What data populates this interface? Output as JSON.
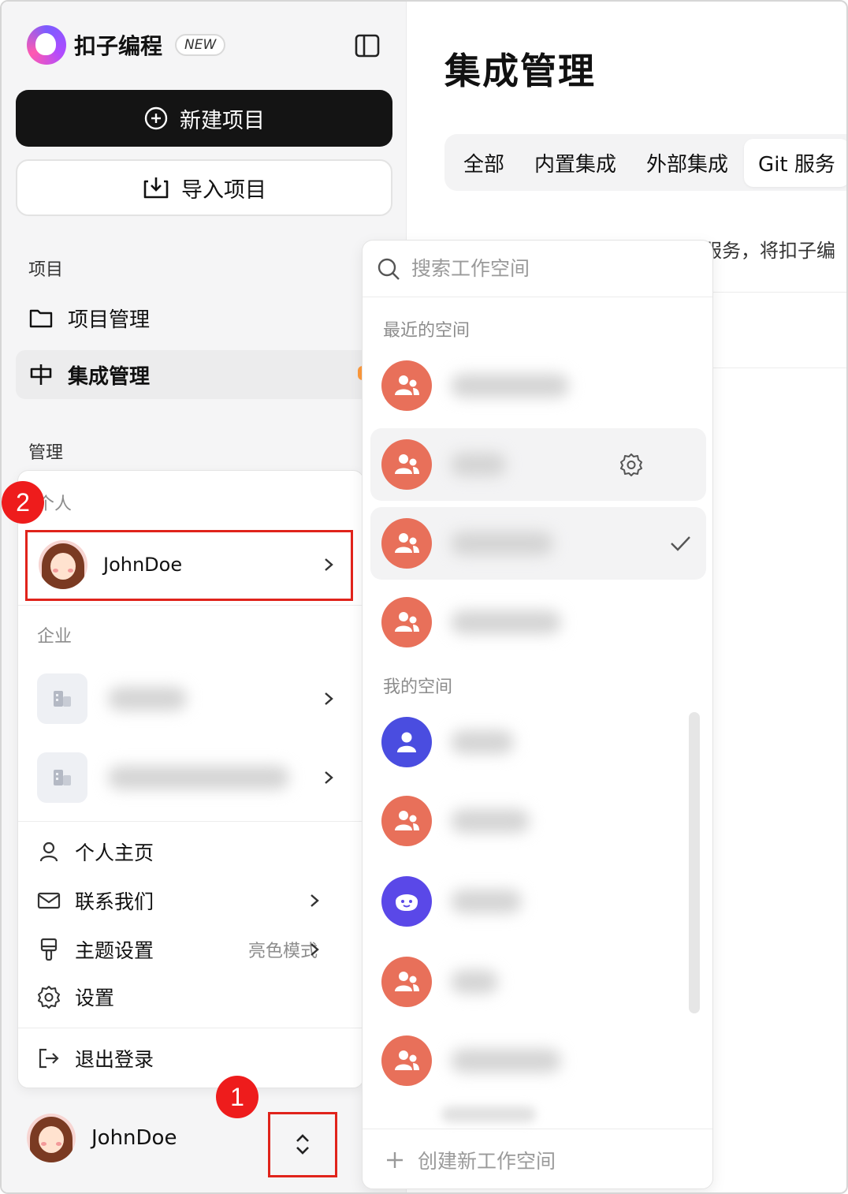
{
  "brand": {
    "name": "扣子编程",
    "tag": "NEW"
  },
  "sidebar": {
    "new_project": "新建项目",
    "import_project": "导入项目",
    "section_projects": "项目",
    "project_management": "项目管理",
    "integration_management": "集成管理",
    "section_admin": "管理"
  },
  "account_menu": {
    "personal_label": "个人",
    "username": "JohnDoe",
    "enterprise_label": "企业",
    "items": [
      {
        "label": "个人主页",
        "extra": ""
      },
      {
        "label": "联系我们",
        "extra": ""
      },
      {
        "label": "主题设置",
        "extra": "亮色模式"
      },
      {
        "label": "设置",
        "extra": ""
      }
    ],
    "logout": "退出登录"
  },
  "bottom_bar": {
    "username": "JohnDoe"
  },
  "annotations": {
    "step1": "1",
    "step2": "2"
  },
  "main": {
    "title": "集成管理",
    "tabs": [
      "全部",
      "内置集成",
      "外部集成",
      "Git 服务"
    ],
    "selected_tab": "Git 服务",
    "description_fragment": "服务，将扣子编"
  },
  "workspace_dropdown": {
    "search_placeholder": "搜索工作空间",
    "recent_label": "最近的空间",
    "mine_label": "我的空间",
    "create_label": "创建新工作空间"
  },
  "colors": {
    "accent_dark": "#141414",
    "annotation_red": "#e0231b",
    "team_avatar": "#e8705a",
    "person_avatar": "#4a4de0",
    "notice_dot": "#ff9a3c"
  }
}
